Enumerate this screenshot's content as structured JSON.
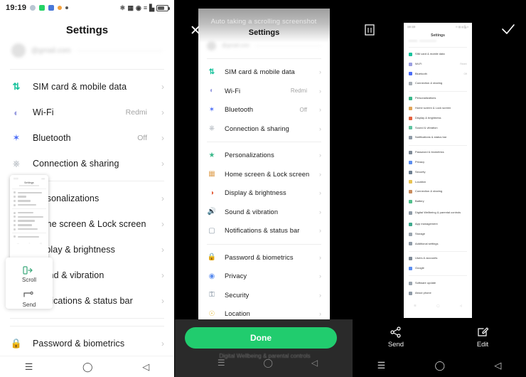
{
  "status_bar": {
    "time": "19:19",
    "notification_icons": [
      "gear-icon",
      "whatsapp-icon",
      "app-blue-icon",
      "app-orange-icon",
      "dot-icon"
    ],
    "right_icons": [
      "nfc-icon",
      "network-icon",
      "wifi-icon",
      "vibrate-icon",
      "signal-icon",
      "battery-icon"
    ]
  },
  "settings": {
    "title": "Settings",
    "account_placeholder": "@gmail.com",
    "groups": [
      {
        "items": [
          {
            "icon": "sim-card-icon",
            "label": "SIM card & mobile data",
            "value": "",
            "color": "#18c29c"
          },
          {
            "icon": "wifi-icon",
            "label": "Wi-Fi",
            "value": "Redmi",
            "color": "#8d8fdc"
          },
          {
            "icon": "bluetooth-icon",
            "label": "Bluetooth",
            "value": "Off",
            "color": "#4a6cf7"
          },
          {
            "icon": "connection-sharing-icon",
            "label": "Connection & sharing",
            "value": "",
            "color": "#9aa0a6"
          }
        ]
      },
      {
        "items": [
          {
            "icon": "personalizations-icon",
            "label": "Personalizations",
            "value": "",
            "color": "#39b88a"
          },
          {
            "icon": "home-lock-screen-icon",
            "label": "Home screen & Lock screen",
            "value": "",
            "color": "#e0a458"
          },
          {
            "icon": "display-brightness-icon",
            "label": "Display & brightness",
            "value": "",
            "color": "#e4603e"
          },
          {
            "icon": "sound-vibration-icon",
            "label": "Sound & vibration",
            "value": "",
            "color": "#5ec4a0"
          },
          {
            "icon": "notifications-status-bar-icon",
            "label": "Notifications & status bar",
            "value": "",
            "color": "#8e9aa6"
          }
        ]
      },
      {
        "items": [
          {
            "icon": "password-biometrics-icon",
            "label": "Password & biometrics",
            "value": "",
            "color": "#7f8a96"
          },
          {
            "icon": "privacy-icon",
            "label": "Privacy",
            "value": "",
            "color": "#5b8def"
          },
          {
            "icon": "security-icon",
            "label": "Security",
            "value": "",
            "color": "#6d7f91"
          },
          {
            "icon": "location-icon",
            "label": "Location",
            "value": "",
            "color": "#e8c251"
          }
        ]
      }
    ]
  },
  "full_settings_list": [
    "SIM card & mobile data",
    "Wi-Fi",
    "Bluetooth",
    "Connection & sharing",
    "Personalizations",
    "Home screen & Lock screen",
    "Display & brightness",
    "Sound & vibration",
    "Notifications & status bar",
    "Password & biometrics",
    "Privacy",
    "Security",
    "Location",
    "Connection & sharing",
    "Battery",
    "Digital Wellbeing & parental controls",
    "App management",
    "Storage",
    "Additional settings",
    "Users & accounts",
    "Google",
    "Software update",
    "About phone"
  ],
  "left_screen": {
    "float_actions": [
      {
        "icon": "scroll-icon",
        "label": "Scroll"
      },
      {
        "icon": "send-icon",
        "label": "Send"
      }
    ],
    "nav": [
      "menu-icon",
      "home-icon",
      "back-icon"
    ]
  },
  "middle_screen": {
    "close_label": "✕",
    "hint": "Auto taking a scrolling screenshot",
    "done_label": "Done",
    "ghost_text": "Digital Wellbeing & parental controls",
    "nav": [
      "menu-icon",
      "home-icon",
      "back-icon"
    ]
  },
  "right_screen": {
    "delete_icon": "trash-icon",
    "confirm_icon": "check-icon",
    "tools": [
      {
        "icon": "share-icon",
        "label": "Send"
      },
      {
        "icon": "edit-icon",
        "label": "Edit"
      }
    ],
    "nav": [
      "menu-icon",
      "home-icon",
      "back-icon"
    ]
  },
  "colors": {
    "accent_green": "#21cc6e",
    "background_black": "#000000",
    "panel_white": "#ffffff",
    "dim_gray": "#2a2a2a"
  }
}
